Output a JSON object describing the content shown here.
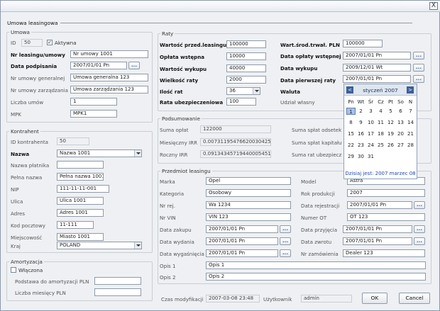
{
  "title_bar": {
    "close_label": "X"
  },
  "tab_title": "Umowa leasingowa",
  "umowa": {
    "group_title": "Umowa",
    "id_label": "ID",
    "id_value": "50",
    "aktywna_label": "Aktywna",
    "aktywna_checked": true,
    "nr_label": "Nr leasingu/umowy",
    "nr_value": "Nr umowy 1001",
    "data_podp_label": "Data podpisania",
    "data_podp_value": "2007/01/01 Pn",
    "nr_gen_label": "Nr umowy generalnej",
    "nr_gen_value": "Umowa generalna 123",
    "nr_zarz_label": "Nr umowy zarządzania",
    "nr_zarz_value": "Umowa zarządzania 123",
    "liczba_label": "Liczba umów",
    "liczba_value": "1",
    "mpk_label": "MPK",
    "mpk_value": "MPK1"
  },
  "kontrahent": {
    "group_title": "Kontrahent",
    "id_label": "ID kontrahenta",
    "id_value": "50",
    "nazwa_label": "Nazwa",
    "nazwa_value": "Nazwa 1001",
    "platnik_label": "Nazwa płatnika",
    "platnik_value": "",
    "pelna_label": "Pełna nazwa",
    "pelna_value": "Pełna nazwa 1001",
    "nip_label": "NIP",
    "nip_value": "111-11-11-001",
    "ulica_label": "Ulica",
    "ulica_value": "Ulica 1001",
    "adres_label": "Adres",
    "adres_value": "Adres 1001",
    "kod_label": "Kod pocztowy",
    "kod_value": "11-111",
    "miejsc_label": "Miejscowość",
    "miejsc_value": "Miasto 1001",
    "kraj_label": "Kraj",
    "kraj_value": "POLAND"
  },
  "amortyzacja": {
    "group_title": "Amortyzacja",
    "wlaczona_label": "Włączona",
    "wlaczona_checked": false,
    "podstawa_label": "Podstawa do amortyzacji PLN",
    "podstawa_value": "",
    "liczba_label": "Liczba miesięcy PLN",
    "liczba_value": ""
  },
  "raty": {
    "group_title": "Raty",
    "wartosc_przed_label": "Wartość przed.leasingu",
    "wartosc_przed_value": "100000",
    "oplata_label": "Opłata wstępna",
    "oplata_value": "10000",
    "wartosc_wykupu_label": "Wartość wykupu",
    "wartosc_wykupu_value": "40000",
    "wielkosc_label": "Wielkość raty",
    "wielkosc_value": "2000",
    "ilosc_label": "Ilość rat",
    "ilosc_value": "36",
    "rata_ubezp_label": "Rata ubezpieczeniowa",
    "rata_ubezp_value": "100",
    "wart_srod_label": "Wart.środ.trwał. PLN",
    "wart_srod_value": "100000",
    "data_oplaty_label": "Data opłaty wstępnej",
    "data_oplaty_value": "2007/01/01 Pn",
    "data_wykupu_label": "Data wykupu",
    "data_wykupu_value": "2009/12/01 Wt",
    "data_pierwszej_label": "Data pierwszej raty",
    "data_pierwszej_value": "2007/01/01 Pn",
    "waluta_label": "Waluta",
    "udzial_label": "Udział własny"
  },
  "podsumowanie": {
    "group_title": "Podsumowanie",
    "suma_oplat_label": "Suma opłat",
    "suma_oplat_value": "122000",
    "irr_m_label": "Miesięczny IRR",
    "irr_m_value": "0.00731195476620030425",
    "irr_r_label": "Roczny IRR",
    "irr_r_value": "0.09134345719440005451",
    "splat_ods_label": "Suma spłat odsetek",
    "splat_kap_label": "Suma spłat kapitału",
    "rat_ubezp_label": "Suma rat ubezpiecz"
  },
  "przedmiot": {
    "group_title": "Przedmiot leasingu",
    "marka_label": "Marka",
    "marka_value": "Opel",
    "kategoria_label": "Kategoria",
    "kategoria_value": "Osobowy",
    "nr_rej_label": "Nr rej.",
    "nr_rej_value": "Wa 1234",
    "nr_vin_label": "Nr VIN",
    "nr_vin_value": "VIN 123",
    "zakupu_label": "Data zakupu",
    "zakupu_value": "2007/01/01 Pn",
    "wydania_label": "Data wydania",
    "wydania_value": "2007/01/01 Pn",
    "wygasniecia_label": "Data wygaśnięcia",
    "wygasniecia_value": "2007/01/01 Pn",
    "model_label": "Model",
    "model_value": "Astra",
    "rok_label": "Rok produkcji",
    "rok_value": "2007",
    "rejestracji_label": "Data rejestracji",
    "rejestracji_value": "2007/01/01 Pn",
    "numer_ot_label": "Numer OT",
    "numer_ot_value": "OT 123",
    "przyjecia_label": "Data przyjęcia",
    "przyjecia_value": "2007/01/01 Pn",
    "zwrotu_label": "Data zwrotu",
    "zwrotu_value": "2007/01/01 Pn",
    "zamowienia_label": "Nr zamówienia",
    "zamowienia_value": "Dealer 123",
    "opis1_label": "Opis 1",
    "opis1_value": "Opis 1",
    "opis2_label": "Opis 2",
    "opis2_value": "Opis 2"
  },
  "footer": {
    "czas_label": "Czas modyfikacji",
    "czas_value": "2007-03-08 23:48",
    "uzytk_label": "Użytkownik",
    "uzytk_value": "admin",
    "ok_label": "OK",
    "cancel_label": "Cancel"
  },
  "calendar": {
    "month_label": "styczeń 2007",
    "prev_label": "<",
    "next_label": ">",
    "day_names": [
      "Pn",
      "Wt",
      "Śr",
      "Cz",
      "Pt",
      "So",
      "N"
    ],
    "days": [
      "1",
      "2",
      "3",
      "4",
      "5",
      "6",
      "7",
      "8",
      "9",
      "10",
      "11",
      "12",
      "13",
      "14",
      "15",
      "16",
      "17",
      "18",
      "19",
      "20",
      "21",
      "22",
      "23",
      "24",
      "25",
      "26",
      "27",
      "28",
      "29",
      "30",
      "31"
    ],
    "today_label": "Dzisiaj jest: 2007 marzec 08",
    "date_button_label": "..."
  }
}
